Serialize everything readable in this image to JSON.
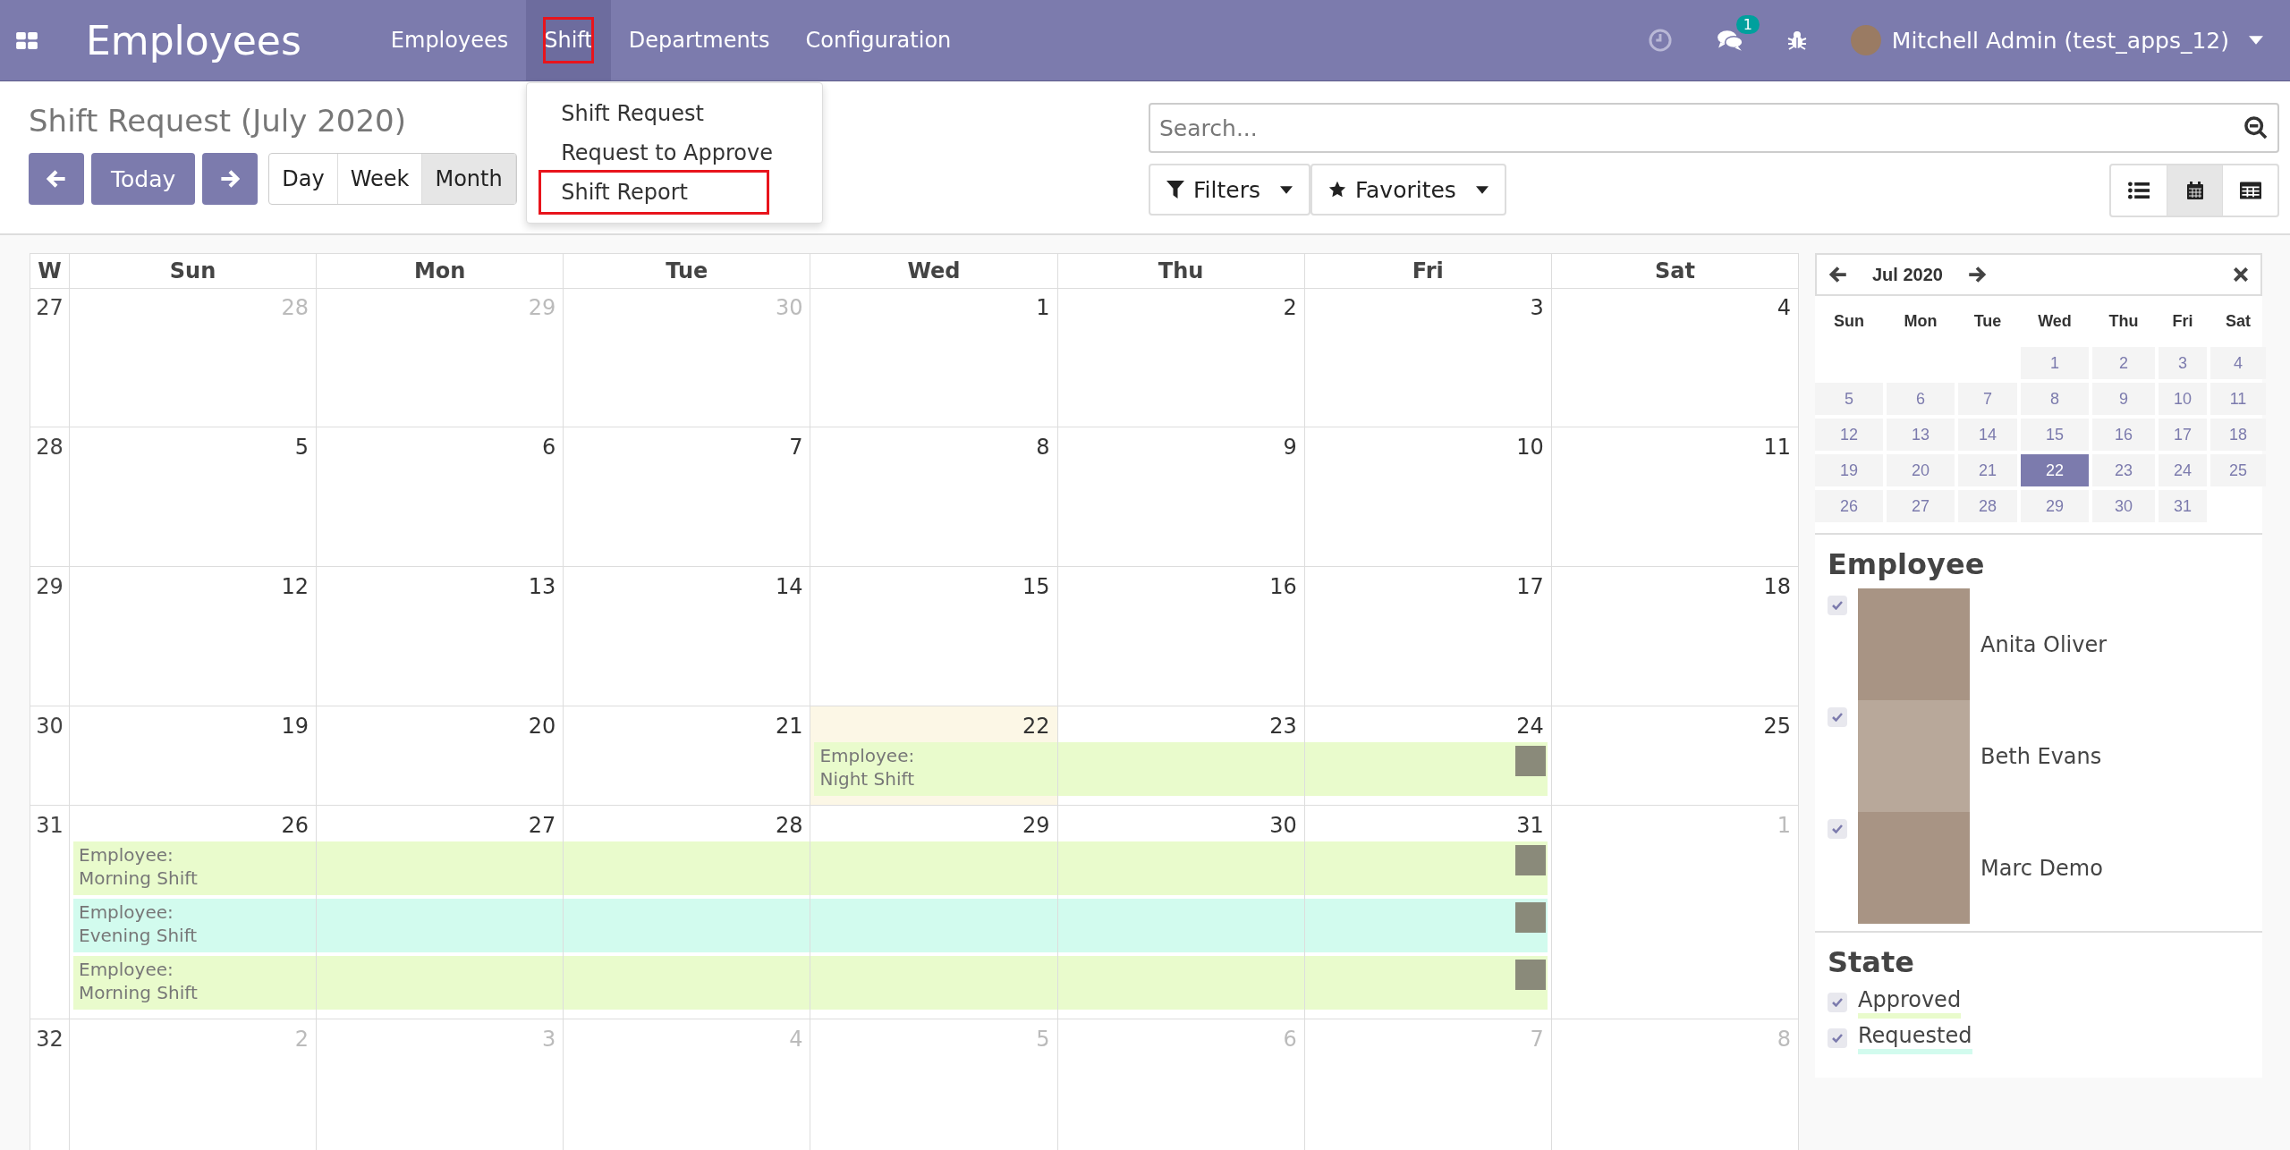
{
  "navbar": {
    "app_name": "Employees",
    "menu": [
      {
        "label": "Employees",
        "selected": false,
        "highlighted": false
      },
      {
        "label": "Shift",
        "selected": true,
        "highlighted": true
      },
      {
        "label": "Departments",
        "selected": false,
        "highlighted": false
      },
      {
        "label": "Configuration",
        "selected": false,
        "highlighted": false
      }
    ],
    "chat_badge": "1",
    "user": "Mitchell Admin (test_apps_12)"
  },
  "dropdown": {
    "items": [
      {
        "label": "Shift Request",
        "highlighted": false
      },
      {
        "label": "Request to Approve",
        "highlighted": false
      },
      {
        "label": "Shift Report",
        "highlighted": true
      }
    ]
  },
  "title": "Shift Request (July 2020)",
  "today_button": "Today",
  "range_modes": [
    {
      "label": "Day",
      "selected": false
    },
    {
      "label": "Week",
      "selected": false
    },
    {
      "label": "Month",
      "selected": true
    }
  ],
  "search": {
    "placeholder": "Search..."
  },
  "filters_button": "Filters",
  "favorites_button": "Favorites",
  "view_switcher": [
    {
      "kind": "list",
      "selected": false
    },
    {
      "kind": "calendar",
      "selected": true
    },
    {
      "kind": "pivot",
      "selected": false
    }
  ],
  "calendar": {
    "headers": [
      "W",
      "Sun",
      "Mon",
      "Tue",
      "Wed",
      "Thu",
      "Fri",
      "Sat"
    ],
    "weeks": [
      {
        "number": "27",
        "days": [
          {
            "label": "28",
            "muted": true,
            "today": false
          },
          {
            "label": "29",
            "muted": true,
            "today": false
          },
          {
            "label": "30",
            "muted": true,
            "today": false
          },
          {
            "label": "1",
            "muted": false,
            "today": false
          },
          {
            "label": "2",
            "muted": false,
            "today": false
          },
          {
            "label": "3",
            "muted": false,
            "today": false
          },
          {
            "label": "4",
            "muted": false,
            "today": false
          }
        ]
      },
      {
        "number": "28",
        "days": [
          {
            "label": "5",
            "muted": false,
            "today": false
          },
          {
            "label": "6",
            "muted": false,
            "today": false
          },
          {
            "label": "7",
            "muted": false,
            "today": false
          },
          {
            "label": "8",
            "muted": false,
            "today": false
          },
          {
            "label": "9",
            "muted": false,
            "today": false
          },
          {
            "label": "10",
            "muted": false,
            "today": false
          },
          {
            "label": "11",
            "muted": false,
            "today": false
          }
        ]
      },
      {
        "number": "29",
        "days": [
          {
            "label": "12",
            "muted": false,
            "today": false
          },
          {
            "label": "13",
            "muted": false,
            "today": false
          },
          {
            "label": "14",
            "muted": false,
            "today": false
          },
          {
            "label": "15",
            "muted": false,
            "today": false
          },
          {
            "label": "16",
            "muted": false,
            "today": false
          },
          {
            "label": "17",
            "muted": false,
            "today": false
          },
          {
            "label": "18",
            "muted": false,
            "today": false
          }
        ]
      },
      {
        "number": "30",
        "days": [
          {
            "label": "19",
            "muted": false,
            "today": false
          },
          {
            "label": "20",
            "muted": false,
            "today": false
          },
          {
            "label": "21",
            "muted": false,
            "today": false
          },
          {
            "label": "22",
            "muted": false,
            "today": true
          },
          {
            "label": "23",
            "muted": false,
            "today": false
          },
          {
            "label": "24",
            "muted": false,
            "today": false
          },
          {
            "label": "25",
            "muted": false,
            "today": false
          }
        ],
        "events": [
          {
            "line1": "Employee:",
            "line2": "Night Shift",
            "color": "#e9fbcc",
            "on_days": [
              false,
              false,
              false,
              true,
              true,
              true,
              false
            ]
          }
        ]
      },
      {
        "number": "31",
        "days": [
          {
            "label": "26",
            "muted": false,
            "today": false
          },
          {
            "label": "27",
            "muted": false,
            "today": false
          },
          {
            "label": "28",
            "muted": false,
            "today": false
          },
          {
            "label": "29",
            "muted": false,
            "today": false
          },
          {
            "label": "30",
            "muted": false,
            "today": false
          },
          {
            "label": "31",
            "muted": false,
            "today": false
          },
          {
            "label": "1",
            "muted": true,
            "today": false
          }
        ],
        "events": [
          {
            "line1": "Employee:",
            "line2": "Morning Shift",
            "color": "#e9fbcc",
            "on_days": [
              true,
              true,
              true,
              true,
              true,
              true,
              false
            ]
          },
          {
            "line1": "Employee:",
            "line2": "Evening Shift",
            "color": "#d2fbee",
            "on_days": [
              true,
              true,
              true,
              true,
              true,
              true,
              false
            ]
          },
          {
            "line1": "Employee:",
            "line2": "Morning Shift",
            "color": "#e9fbcc",
            "on_days": [
              true,
              true,
              true,
              true,
              true,
              true,
              false
            ]
          }
        ]
      },
      {
        "number": "32",
        "days": [
          {
            "label": "2",
            "muted": true,
            "today": false
          },
          {
            "label": "3",
            "muted": true,
            "today": false
          },
          {
            "label": "4",
            "muted": true,
            "today": false
          },
          {
            "label": "5",
            "muted": true,
            "today": false
          },
          {
            "label": "6",
            "muted": true,
            "today": false
          },
          {
            "label": "7",
            "muted": true,
            "today": false
          },
          {
            "label": "8",
            "muted": true,
            "today": false
          }
        ]
      }
    ]
  },
  "mini_calendar": {
    "month": "Jul 2020",
    "headers": [
      "Sun",
      "Mon",
      "Tue",
      "Wed",
      "Thu",
      "Fri",
      "Sat"
    ],
    "weeks": [
      [
        {
          "label": "1",
          "selected": false
        },
        {
          "label": "2",
          "selected": false
        },
        {
          "label": "3",
          "selected": false
        },
        {
          "label": "4",
          "selected": false
        }
      ],
      [
        {
          "label": "5",
          "selected": false
        },
        {
          "label": "6",
          "selected": false
        },
        {
          "label": "7",
          "selected": false
        },
        {
          "label": "8",
          "selected": false
        },
        {
          "label": "9",
          "selected": false
        },
        {
          "label": "10",
          "selected": false
        },
        {
          "label": "11",
          "selected": false
        }
      ],
      [
        {
          "label": "12",
          "selected": false
        },
        {
          "label": "13",
          "selected": false
        },
        {
          "label": "14",
          "selected": false
        },
        {
          "label": "15",
          "selected": false
        },
        {
          "label": "16",
          "selected": false
        },
        {
          "label": "17",
          "selected": false
        },
        {
          "label": "18",
          "selected": false
        }
      ],
      [
        {
          "label": "19",
          "selected": false
        },
        {
          "label": "20",
          "selected": false
        },
        {
          "label": "21",
          "selected": false
        },
        {
          "label": "22",
          "selected": true
        },
        {
          "label": "23",
          "selected": false
        },
        {
          "label": "24",
          "selected": false
        },
        {
          "label": "25",
          "selected": false
        }
      ],
      [
        {
          "label": "26",
          "selected": false
        },
        {
          "label": "27",
          "selected": false
        },
        {
          "label": "28",
          "selected": false
        },
        {
          "label": "29",
          "selected": false
        },
        {
          "label": "30",
          "selected": false
        },
        {
          "label": "31",
          "selected": false
        }
      ]
    ]
  },
  "employee_filter": {
    "title": "Employee",
    "items": [
      {
        "name": "Anita Oliver",
        "checked": true
      },
      {
        "name": "Beth Evans",
        "checked": true
      },
      {
        "name": "Marc Demo",
        "checked": true
      }
    ]
  },
  "state_filter": {
    "title": "State",
    "items": [
      {
        "label": "Approved",
        "checked": true,
        "color": "#e9fbcc"
      },
      {
        "label": "Requested",
        "checked": true,
        "color": "#d2fbee"
      }
    ]
  }
}
